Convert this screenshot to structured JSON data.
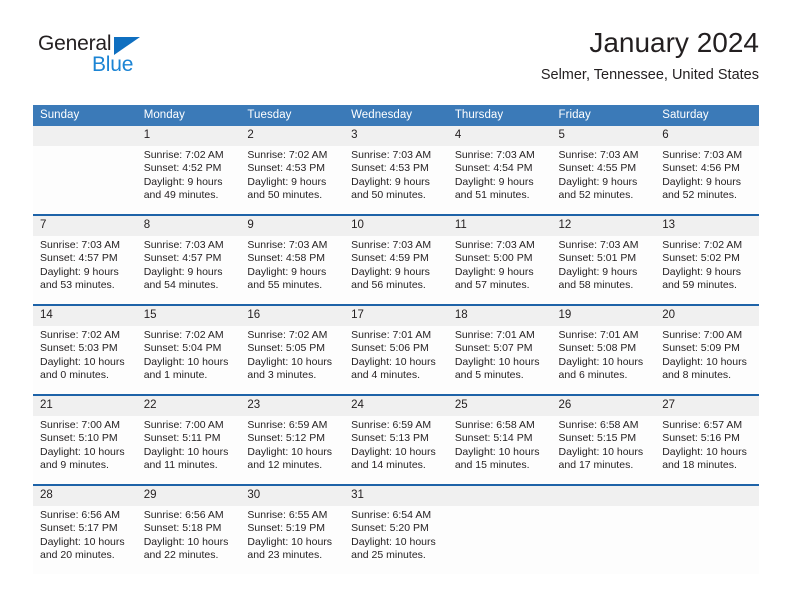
{
  "brand": {
    "name_part1": "General",
    "name_part2": "Blue",
    "accent_color": "#1b84d4",
    "triangle_color": "#0f6fc0"
  },
  "header": {
    "title": "January 2024",
    "subtitle": "Selmer, Tennessee, United States",
    "header_bg_color": "#3b7ab8",
    "separator_color": "#1e63a8",
    "daynum_bg_color": "#f0f0f0"
  },
  "weekdays": [
    "Sunday",
    "Monday",
    "Tuesday",
    "Wednesday",
    "Thursday",
    "Friday",
    "Saturday"
  ],
  "weeks": [
    {
      "days": [
        {
          "num": "",
          "sunrise": "",
          "sunset": "",
          "daylight1": "",
          "daylight2": ""
        },
        {
          "num": "1",
          "sunrise": "Sunrise: 7:02 AM",
          "sunset": "Sunset: 4:52 PM",
          "daylight1": "Daylight: 9 hours",
          "daylight2": "and 49 minutes."
        },
        {
          "num": "2",
          "sunrise": "Sunrise: 7:02 AM",
          "sunset": "Sunset: 4:53 PM",
          "daylight1": "Daylight: 9 hours",
          "daylight2": "and 50 minutes."
        },
        {
          "num": "3",
          "sunrise": "Sunrise: 7:03 AM",
          "sunset": "Sunset: 4:53 PM",
          "daylight1": "Daylight: 9 hours",
          "daylight2": "and 50 minutes."
        },
        {
          "num": "4",
          "sunrise": "Sunrise: 7:03 AM",
          "sunset": "Sunset: 4:54 PM",
          "daylight1": "Daylight: 9 hours",
          "daylight2": "and 51 minutes."
        },
        {
          "num": "5",
          "sunrise": "Sunrise: 7:03 AM",
          "sunset": "Sunset: 4:55 PM",
          "daylight1": "Daylight: 9 hours",
          "daylight2": "and 52 minutes."
        },
        {
          "num": "6",
          "sunrise": "Sunrise: 7:03 AM",
          "sunset": "Sunset: 4:56 PM",
          "daylight1": "Daylight: 9 hours",
          "daylight2": "and 52 minutes."
        }
      ]
    },
    {
      "days": [
        {
          "num": "7",
          "sunrise": "Sunrise: 7:03 AM",
          "sunset": "Sunset: 4:57 PM",
          "daylight1": "Daylight: 9 hours",
          "daylight2": "and 53 minutes."
        },
        {
          "num": "8",
          "sunrise": "Sunrise: 7:03 AM",
          "sunset": "Sunset: 4:57 PM",
          "daylight1": "Daylight: 9 hours",
          "daylight2": "and 54 minutes."
        },
        {
          "num": "9",
          "sunrise": "Sunrise: 7:03 AM",
          "sunset": "Sunset: 4:58 PM",
          "daylight1": "Daylight: 9 hours",
          "daylight2": "and 55 minutes."
        },
        {
          "num": "10",
          "sunrise": "Sunrise: 7:03 AM",
          "sunset": "Sunset: 4:59 PM",
          "daylight1": "Daylight: 9 hours",
          "daylight2": "and 56 minutes."
        },
        {
          "num": "11",
          "sunrise": "Sunrise: 7:03 AM",
          "sunset": "Sunset: 5:00 PM",
          "daylight1": "Daylight: 9 hours",
          "daylight2": "and 57 minutes."
        },
        {
          "num": "12",
          "sunrise": "Sunrise: 7:03 AM",
          "sunset": "Sunset: 5:01 PM",
          "daylight1": "Daylight: 9 hours",
          "daylight2": "and 58 minutes."
        },
        {
          "num": "13",
          "sunrise": "Sunrise: 7:02 AM",
          "sunset": "Sunset: 5:02 PM",
          "daylight1": "Daylight: 9 hours",
          "daylight2": "and 59 minutes."
        }
      ]
    },
    {
      "days": [
        {
          "num": "14",
          "sunrise": "Sunrise: 7:02 AM",
          "sunset": "Sunset: 5:03 PM",
          "daylight1": "Daylight: 10 hours",
          "daylight2": "and 0 minutes."
        },
        {
          "num": "15",
          "sunrise": "Sunrise: 7:02 AM",
          "sunset": "Sunset: 5:04 PM",
          "daylight1": "Daylight: 10 hours",
          "daylight2": "and 1 minute."
        },
        {
          "num": "16",
          "sunrise": "Sunrise: 7:02 AM",
          "sunset": "Sunset: 5:05 PM",
          "daylight1": "Daylight: 10 hours",
          "daylight2": "and 3 minutes."
        },
        {
          "num": "17",
          "sunrise": "Sunrise: 7:01 AM",
          "sunset": "Sunset: 5:06 PM",
          "daylight1": "Daylight: 10 hours",
          "daylight2": "and 4 minutes."
        },
        {
          "num": "18",
          "sunrise": "Sunrise: 7:01 AM",
          "sunset": "Sunset: 5:07 PM",
          "daylight1": "Daylight: 10 hours",
          "daylight2": "and 5 minutes."
        },
        {
          "num": "19",
          "sunrise": "Sunrise: 7:01 AM",
          "sunset": "Sunset: 5:08 PM",
          "daylight1": "Daylight: 10 hours",
          "daylight2": "and 6 minutes."
        },
        {
          "num": "20",
          "sunrise": "Sunrise: 7:00 AM",
          "sunset": "Sunset: 5:09 PM",
          "daylight1": "Daylight: 10 hours",
          "daylight2": "and 8 minutes."
        }
      ]
    },
    {
      "days": [
        {
          "num": "21",
          "sunrise": "Sunrise: 7:00 AM",
          "sunset": "Sunset: 5:10 PM",
          "daylight1": "Daylight: 10 hours",
          "daylight2": "and 9 minutes."
        },
        {
          "num": "22",
          "sunrise": "Sunrise: 7:00 AM",
          "sunset": "Sunset: 5:11 PM",
          "daylight1": "Daylight: 10 hours",
          "daylight2": "and 11 minutes."
        },
        {
          "num": "23",
          "sunrise": "Sunrise: 6:59 AM",
          "sunset": "Sunset: 5:12 PM",
          "daylight1": "Daylight: 10 hours",
          "daylight2": "and 12 minutes."
        },
        {
          "num": "24",
          "sunrise": "Sunrise: 6:59 AM",
          "sunset": "Sunset: 5:13 PM",
          "daylight1": "Daylight: 10 hours",
          "daylight2": "and 14 minutes."
        },
        {
          "num": "25",
          "sunrise": "Sunrise: 6:58 AM",
          "sunset": "Sunset: 5:14 PM",
          "daylight1": "Daylight: 10 hours",
          "daylight2": "and 15 minutes."
        },
        {
          "num": "26",
          "sunrise": "Sunrise: 6:58 AM",
          "sunset": "Sunset: 5:15 PM",
          "daylight1": "Daylight: 10 hours",
          "daylight2": "and 17 minutes."
        },
        {
          "num": "27",
          "sunrise": "Sunrise: 6:57 AM",
          "sunset": "Sunset: 5:16 PM",
          "daylight1": "Daylight: 10 hours",
          "daylight2": "and 18 minutes."
        }
      ]
    },
    {
      "days": [
        {
          "num": "28",
          "sunrise": "Sunrise: 6:56 AM",
          "sunset": "Sunset: 5:17 PM",
          "daylight1": "Daylight: 10 hours",
          "daylight2": "and 20 minutes."
        },
        {
          "num": "29",
          "sunrise": "Sunrise: 6:56 AM",
          "sunset": "Sunset: 5:18 PM",
          "daylight1": "Daylight: 10 hours",
          "daylight2": "and 22 minutes."
        },
        {
          "num": "30",
          "sunrise": "Sunrise: 6:55 AM",
          "sunset": "Sunset: 5:19 PM",
          "daylight1": "Daylight: 10 hours",
          "daylight2": "and 23 minutes."
        },
        {
          "num": "31",
          "sunrise": "Sunrise: 6:54 AM",
          "sunset": "Sunset: 5:20 PM",
          "daylight1": "Daylight: 10 hours",
          "daylight2": "and 25 minutes."
        },
        {
          "num": "",
          "sunrise": "",
          "sunset": "",
          "daylight1": "",
          "daylight2": ""
        },
        {
          "num": "",
          "sunrise": "",
          "sunset": "",
          "daylight1": "",
          "daylight2": ""
        },
        {
          "num": "",
          "sunrise": "",
          "sunset": "",
          "daylight1": "",
          "daylight2": ""
        }
      ]
    }
  ]
}
